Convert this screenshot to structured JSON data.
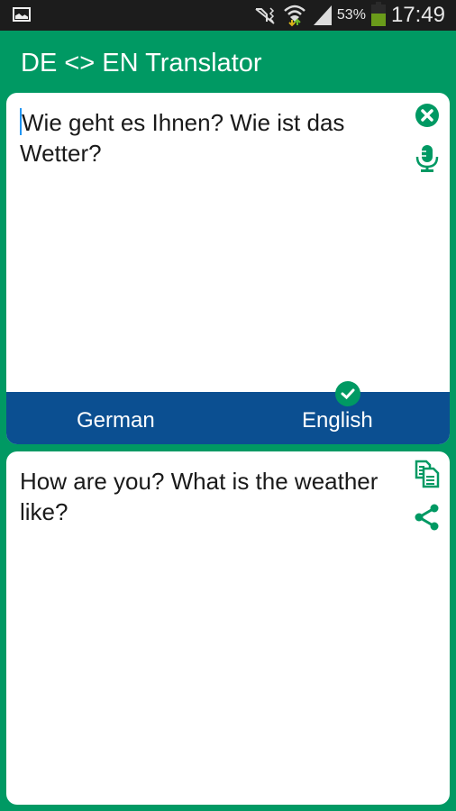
{
  "status_bar": {
    "left_icon": "gallery-icon",
    "icons": [
      "mute-icon",
      "wifi-icon",
      "signal-icon"
    ],
    "battery_percent": "53%",
    "time": "17:49"
  },
  "app_bar": {
    "title": "DE <> EN Translator"
  },
  "source": {
    "text": "Wie geht es Ihnen? Wie ist das Wetter?",
    "actions": {
      "clear": "clear-icon",
      "voice": "microphone-icon"
    }
  },
  "languages": {
    "from": "German",
    "to": "English",
    "selected": "English"
  },
  "result": {
    "text": "How are you? What is the weather like?",
    "actions": {
      "copy": "copy-icon",
      "share": "share-icon"
    }
  },
  "colors": {
    "primary": "#009963",
    "lang_bar": "#0b4f91",
    "status_bar": "#1c1c1c",
    "caret": "#2196f3"
  }
}
